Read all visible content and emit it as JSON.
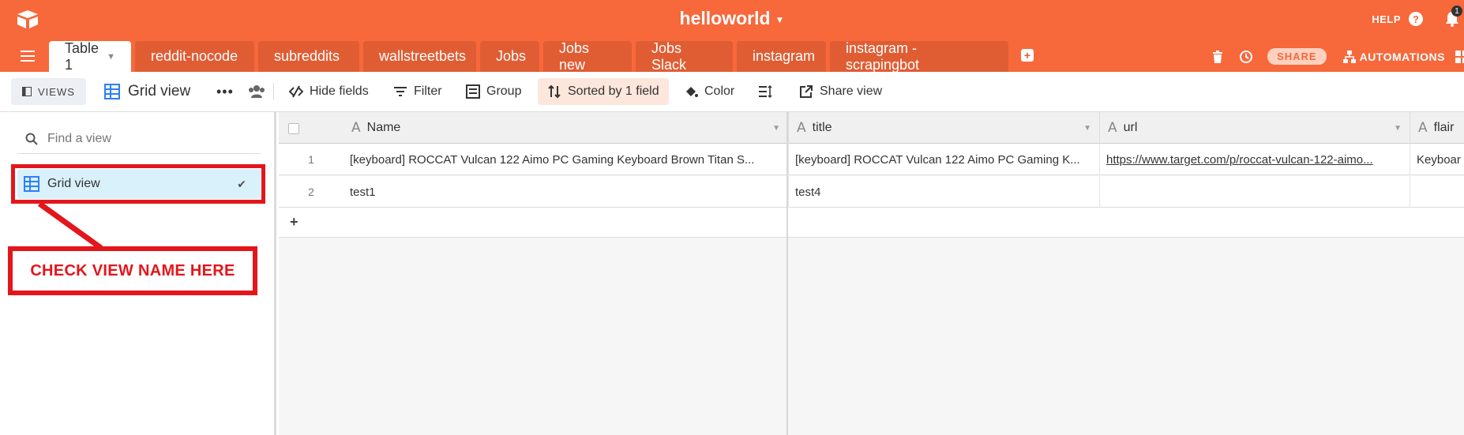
{
  "app": {
    "base_title": "helloworld",
    "help_label": "HELP",
    "help_icon": "help-circle-icon",
    "notification_count": "1",
    "accent_color": "#f7683b"
  },
  "tabs": [
    {
      "label": "Table 1",
      "active": true
    },
    {
      "label": "reddit-nocode"
    },
    {
      "label": "subreddits"
    },
    {
      "label": "wallstreetbets"
    },
    {
      "label": "Jobs"
    },
    {
      "label": "Jobs new"
    },
    {
      "label": "Jobs Slack"
    },
    {
      "label": "instagram"
    },
    {
      "label": "instagram - scrapingbot"
    }
  ],
  "tab_tools": {
    "share_label": "SHARE",
    "automations_label": "AUTOMATIONS"
  },
  "toolbar": {
    "views_label": "VIEWS",
    "current_view": "Grid view",
    "hide_fields": "Hide fields",
    "filter": "Filter",
    "group": "Group",
    "sorted": "Sorted by 1 field",
    "color": "Color",
    "share_view": "Share view"
  },
  "sidebar": {
    "search_placeholder": "Find a view",
    "views": [
      {
        "label": "Grid view",
        "selected": true
      }
    ],
    "annotation": "CHECK VIEW NAME HERE",
    "annotation_color": "#e3161b"
  },
  "grid": {
    "columns": [
      "Name",
      "title",
      "url",
      "flair"
    ],
    "rows": [
      {
        "num": "1",
        "name": "[keyboard] ROCCAT Vulcan 122 Aimo PC Gaming Keyboard Brown Titan S...",
        "title": "[keyboard] ROCCAT Vulcan 122 Aimo PC Gaming K...",
        "url": "https://www.target.com/p/roccat-vulcan-122-aimo...",
        "flair": "Keyboar"
      },
      {
        "num": "2",
        "name": "test1",
        "title": "test4",
        "url": "",
        "flair": ""
      }
    ],
    "add_row": "+"
  }
}
